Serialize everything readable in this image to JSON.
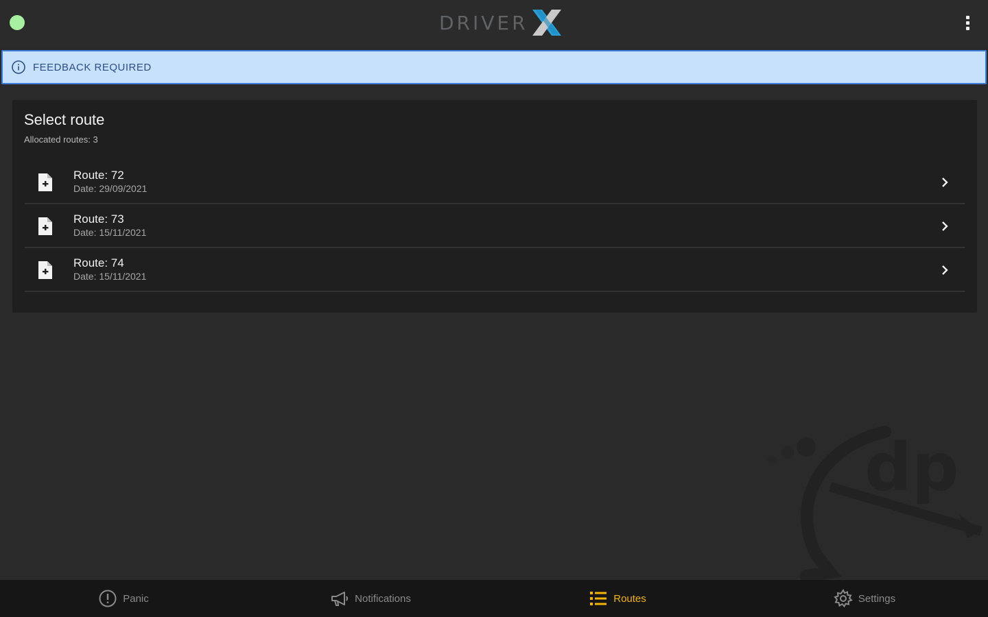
{
  "header": {
    "logo_text": "DRIVER",
    "logo_accent": "X",
    "status_color": "#a7f0a0"
  },
  "banner": {
    "text": "FEEDBACK REQUIRED",
    "icon": "info-icon"
  },
  "card": {
    "title": "Select route",
    "subtitle": "Allocated routes: 3"
  },
  "routes": [
    {
      "name": "Route: 72",
      "date": "Date: 29/09/2021"
    },
    {
      "name": "Route: 73",
      "date": "Date: 15/11/2021"
    },
    {
      "name": "Route: 74",
      "date": "Date: 15/11/2021"
    }
  ],
  "nav": {
    "panic": "Panic",
    "notifications": "Notifications",
    "routes": "Routes",
    "settings": "Settings",
    "active": "routes",
    "accent_color": "#f4b400"
  }
}
